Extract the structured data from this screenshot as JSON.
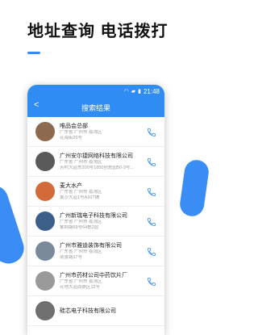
{
  "promo": {
    "title": "地址查询 电话拨打"
  },
  "status_bar": {
    "time": "21:48"
  },
  "nav": {
    "title": "搜索结果",
    "back_icon": "chevron-left-icon"
  },
  "colors": {
    "accent": "#2e8cf2",
    "call": "#2f8cf0"
  },
  "results": [
    {
      "name": "唯品会总部",
      "line1": "广东省 广州市 荔湾区",
      "line2": "花海街20号",
      "thumb": "#8c6a4f"
    },
    {
      "name": "广州安尔捷网络科技有限公司",
      "line1": "广东省 广州市 荔湾区",
      "line2": "芳村大道东200号1850创意园50-3号...",
      "thumb": "#5a5a5a"
    },
    {
      "name": "麦大水产",
      "line1": "广东省 广州市 荔湾区",
      "line2": "黄沙大道1号A107铺",
      "thumb": "#d26a3a"
    },
    {
      "name": "广州新瑞电子科技有限公司",
      "line1": "广东省 广州市 荔湾区",
      "line2": "紫荆路69号64栋2层",
      "thumb": "#3c5f8a"
    },
    {
      "name": "广州市雅迪装饰有限公司",
      "line1": "广东省 广州市 荔湾区",
      "line2": "荷景路17号",
      "thumb": "#7b8a9a"
    },
    {
      "name": "广州市药材公司中药饮片厂",
      "line1": "广东省 广州市 荔湾区",
      "line2": "花地大道西侧区12号",
      "thumb": "#9a9a9a"
    },
    {
      "name": "硅芯电子科技有限公司",
      "line1": "",
      "line2": "",
      "thumb": "#6f6f6f"
    }
  ]
}
